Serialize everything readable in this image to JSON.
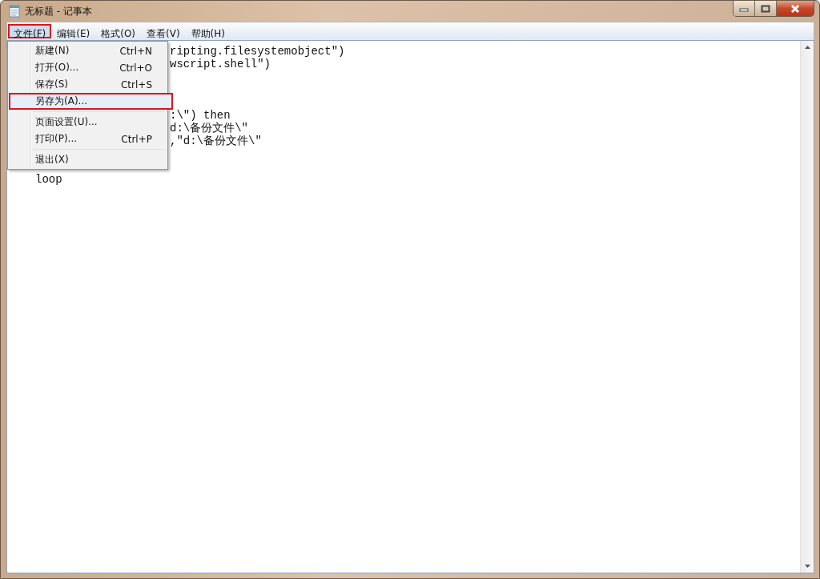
{
  "window": {
    "title": "无标题 - 记事本"
  },
  "menubar": [
    {
      "label": "文件(F)",
      "selected": true,
      "highlighted": true
    },
    {
      "label": "编辑(E)",
      "selected": false,
      "highlighted": false
    },
    {
      "label": "格式(O)",
      "selected": false,
      "highlighted": false
    },
    {
      "label": "查看(V)",
      "selected": false,
      "highlighted": false
    },
    {
      "label": "帮助(H)",
      "selected": false,
      "highlighted": false
    }
  ],
  "file_menu": [
    {
      "kind": "item",
      "label": "新建(N)",
      "shortcut": "Ctrl+N",
      "highlighted": false
    },
    {
      "kind": "item",
      "label": "打开(O)...",
      "shortcut": "Ctrl+O",
      "highlighted": false
    },
    {
      "kind": "item",
      "label": "保存(S)",
      "shortcut": "Ctrl+S",
      "highlighted": false
    },
    {
      "kind": "item",
      "label": "另存为(A)...",
      "highlighted": true
    },
    {
      "kind": "separator"
    },
    {
      "kind": "item",
      "label": "页面设置(U)...",
      "highlighted": false
    },
    {
      "kind": "item",
      "label": "打印(P)...",
      "shortcut": "Ctrl+P",
      "highlighted": false
    },
    {
      "kind": "separator"
    },
    {
      "kind": "item",
      "label": "退出(X)",
      "highlighted": false
    }
  ],
  "editor_lines": [
    {
      "kind": "behind_menu",
      "text": "ripting.filesystemobject\")"
    },
    {
      "kind": "behind_menu",
      "text": "wscript.shell\")"
    },
    {
      "kind": "blank"
    },
    {
      "kind": "blank"
    },
    {
      "kind": "blank"
    },
    {
      "kind": "behind_menu",
      "text": ":\\\") then"
    },
    {
      "kind": "behind_menu",
      "text": "d:\\备份文件\\\""
    },
    {
      "kind": "behind_menu",
      "text": ",\"d:\\备份文件\\\""
    },
    {
      "kind": "blank"
    },
    {
      "kind": "blank"
    },
    {
      "kind": "full",
      "text": "loop"
    }
  ]
}
